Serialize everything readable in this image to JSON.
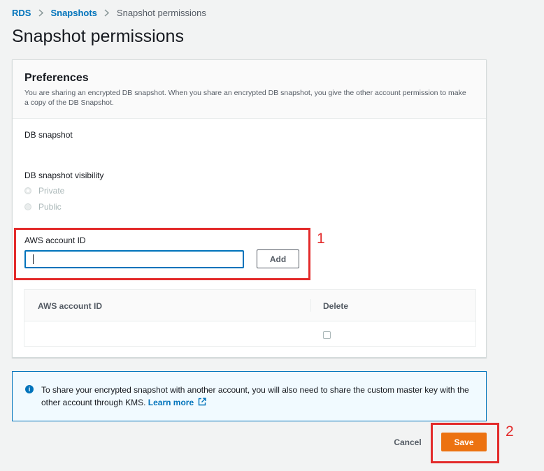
{
  "breadcrumb": {
    "items": [
      {
        "label": "RDS"
      },
      {
        "label": "Snapshots"
      },
      {
        "label": "Snapshot permissions"
      }
    ]
  },
  "page_title": "Snapshot permissions",
  "preferences": {
    "title": "Preferences",
    "description": "You are sharing an encrypted DB snapshot. When you share an encrypted DB snapshot, you give the other account permission to make a copy of the DB Snapshot.",
    "db_snapshot_label": "DB snapshot",
    "visibility_label": "DB snapshot visibility",
    "visibility_options": [
      {
        "label": "Private",
        "selected": true
      },
      {
        "label": "Public",
        "selected": false
      }
    ],
    "account_id_label": "AWS account ID",
    "account_id_value": "",
    "add_button": "Add",
    "table": {
      "columns": [
        "AWS account ID",
        "Delete"
      ]
    }
  },
  "alert": {
    "text": "To share your encrypted snapshot with another account, you will also need to share the custom master key with the other account through KMS.",
    "link": "Learn more",
    "icon": "info-icon"
  },
  "actions": {
    "cancel": "Cancel",
    "save": "Save"
  },
  "annotations": [
    "1",
    "2"
  ],
  "colors": {
    "accent": "#0073bb",
    "primary_button": "#ec7211",
    "annotation": "#e32b2b"
  }
}
